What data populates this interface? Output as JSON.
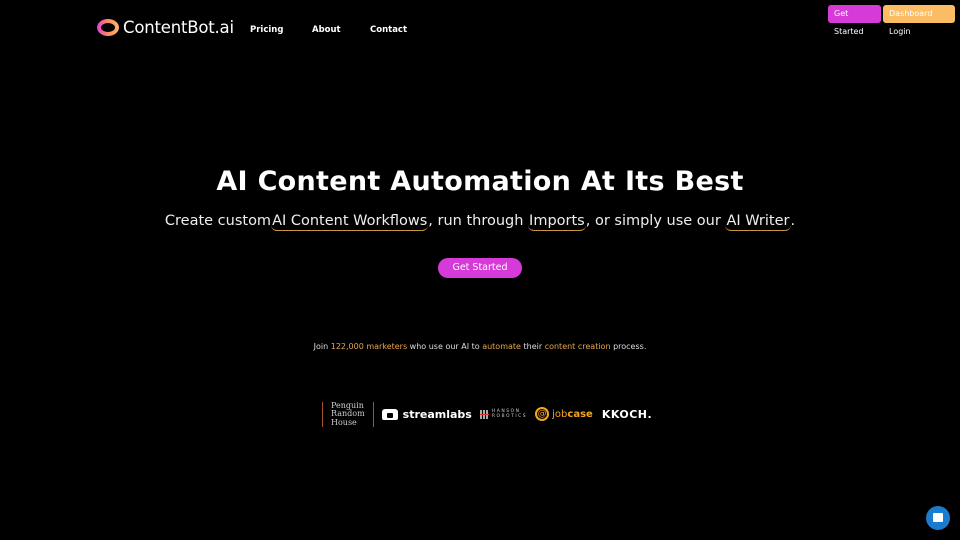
{
  "brand": {
    "name": "ContentBot.ai",
    "gradient": [
      "#e040d8",
      "#ffb86b"
    ]
  },
  "nav": {
    "links": [
      "Pricing",
      "About",
      "Contact"
    ],
    "get_started": "Get Started",
    "dashboard_login": "Dashboard Login"
  },
  "hero": {
    "title": "AI Content Automation At Its Best",
    "sub_1": "Create custom",
    "link_workflows": "AI Content Workflows",
    "sub_2": ", run through ",
    "link_imports": "Imports",
    "sub_3": ", or simply use our ",
    "link_writer": "AI Writer",
    "sub_4": ".",
    "cta": "Get Started"
  },
  "social_proof": {
    "t1": "Join ",
    "h1": "122,000 marketers",
    "t2": " who use our AI to ",
    "h2": "automate",
    "t3": " their ",
    "h3": "content creation",
    "t4": " process."
  },
  "logos": {
    "prh": [
      "Penguin",
      "Random",
      "House"
    ],
    "streamlabs": "streamlabs",
    "hanson": [
      "HANSON",
      "ROBOTICS"
    ],
    "jobcase_j": "job",
    "jobcase_c": "case",
    "koch": "KKOCH."
  },
  "colors": {
    "accent": "#d63ad8",
    "secondary": "#fbbd64",
    "highlight": "#e8a64a",
    "chat": "#1a7ccf"
  }
}
